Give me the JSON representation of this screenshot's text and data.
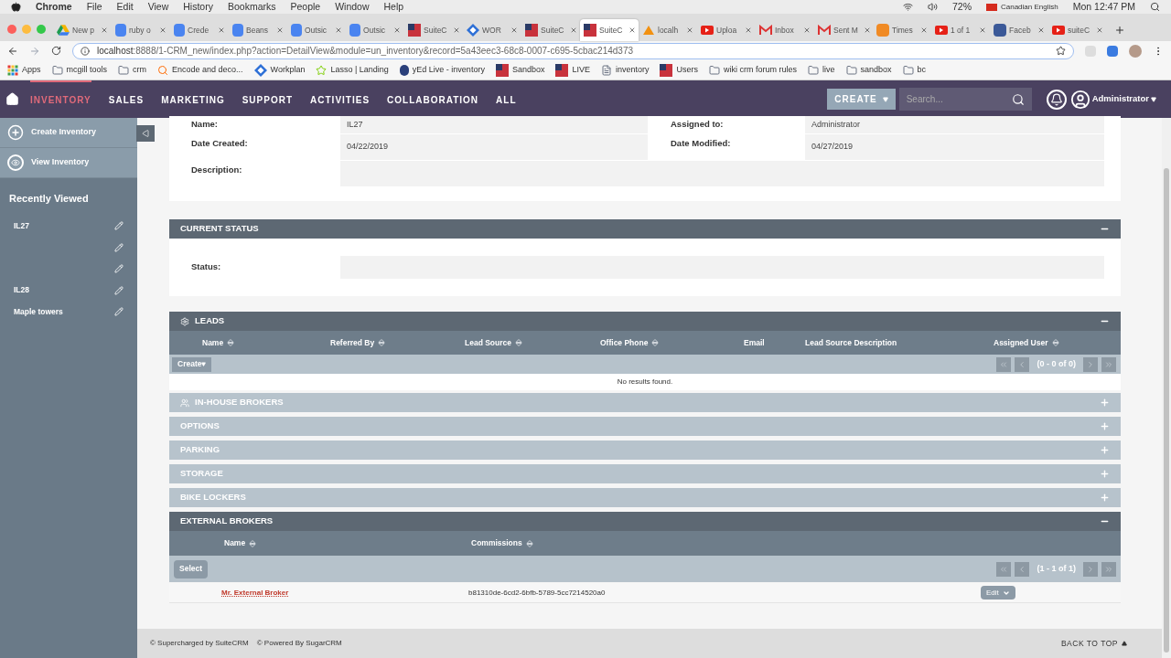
{
  "mac_menu": {
    "app": "Chrome",
    "items": [
      "File",
      "Edit",
      "View",
      "History",
      "Bookmarks",
      "People",
      "Window",
      "Help"
    ],
    "battery": "72%",
    "language": "Canadian English",
    "clock": "Mon 12:47 PM"
  },
  "browser_tabs": [
    {
      "label": "New p",
      "kind": "drive",
      "selected": false
    },
    {
      "label": "ruby o",
      "kind": "doc",
      "selected": false
    },
    {
      "label": "Crede",
      "kind": "doc",
      "selected": false
    },
    {
      "label": "Beans",
      "kind": "doc",
      "selected": false
    },
    {
      "label": "Outsic",
      "kind": "doc",
      "selected": false
    },
    {
      "label": "Outsic",
      "kind": "doc",
      "selected": false
    },
    {
      "label": "SuiteC",
      "kind": "suite",
      "selected": false
    },
    {
      "label": "WOR",
      "kind": "diamond",
      "selected": false
    },
    {
      "label": "SuiteC",
      "kind": "suite",
      "selected": false
    },
    {
      "label": "SuiteC",
      "kind": "suite",
      "selected": true
    },
    {
      "label": "localh",
      "kind": "pma",
      "selected": false
    },
    {
      "label": "Uploa",
      "kind": "youtube",
      "selected": false
    },
    {
      "label": "Inbox",
      "kind": "gmail",
      "selected": false
    },
    {
      "label": "Sent M",
      "kind": "gmail",
      "selected": false
    },
    {
      "label": "Times",
      "kind": "letter",
      "selected": false
    },
    {
      "label": "1 of 1",
      "kind": "youtube",
      "selected": false
    },
    {
      "label": "Faceb",
      "kind": "facebook",
      "selected": false
    },
    {
      "label": "suiteC",
      "kind": "youtube",
      "selected": false
    }
  ],
  "address_bar": {
    "host": "localhost",
    "path": ":8888/1-CRM_new/index.php?action=DetailView&module=un_inventory&record=5a43eec3-68c8-0007-c695-5cbac214d373"
  },
  "bookmarks": [
    {
      "label": "Apps",
      "kind": "apps"
    },
    {
      "label": "mcgill tools",
      "kind": "folder"
    },
    {
      "label": "crm",
      "kind": "folder"
    },
    {
      "label": "Encode and deco...",
      "kind": "search"
    },
    {
      "label": "Workplan",
      "kind": "diamond"
    },
    {
      "label": "Lasso | Landing",
      "kind": "star"
    },
    {
      "label": "yEd Live - inventory",
      "kind": "yed"
    },
    {
      "label": "Sandbox",
      "kind": "suite"
    },
    {
      "label": "LIVE",
      "kind": "suite"
    },
    {
      "label": "inventory",
      "kind": "page"
    },
    {
      "label": "Users",
      "kind": "suite"
    },
    {
      "label": "wiki crm forum rules",
      "kind": "folder"
    },
    {
      "label": "live",
      "kind": "folder"
    },
    {
      "label": "sandbox",
      "kind": "folder"
    },
    {
      "label": "bc",
      "kind": "folder"
    }
  ],
  "nav": {
    "items": [
      {
        "label": "INVENTORY",
        "selected": true
      },
      {
        "label": "SALES",
        "selected": false
      },
      {
        "label": "MARKETING",
        "selected": false
      },
      {
        "label": "SUPPORT",
        "selected": false
      },
      {
        "label": "ACTIVITIES",
        "selected": false
      },
      {
        "label": "COLLABORATION",
        "selected": false
      },
      {
        "label": "ALL",
        "selected": false
      }
    ],
    "create": "CREATE",
    "search_placeholder": "Search...",
    "user": "Administrator"
  },
  "sidebar": {
    "actions": [
      {
        "label": "Create Inventory",
        "kind": "create"
      },
      {
        "label": "View Inventory",
        "kind": "view"
      }
    ],
    "recently_viewed_title": "Recently Viewed",
    "recent": [
      {
        "kind": "named",
        "label": "IL27"
      },
      {
        "kind": "untitled"
      },
      {
        "kind": "untitled"
      },
      {
        "kind": "named",
        "label": "IL28"
      },
      {
        "kind": "named",
        "label": "Maple towers"
      }
    ]
  },
  "detail": {
    "rows": [
      [
        {
          "label": "Name:",
          "value": "IL27"
        },
        {
          "label": "Assigned to:",
          "value": "Administrator"
        }
      ],
      [
        {
          "label": "Date Created:",
          "value": "04/22/2019"
        },
        {
          "label": "Date Modified:",
          "value": "04/27/2019"
        }
      ],
      [
        {
          "label": "Description:"
        }
      ]
    ]
  },
  "current_status": {
    "title": "CURRENT STATUS",
    "expanded": true,
    "fields": [
      {
        "label": "Status:"
      }
    ]
  },
  "leads": {
    "title": "LEADS",
    "expanded": true,
    "columns": [
      {
        "label": "Name",
        "sortable": true
      },
      {
        "label": "Referred By",
        "sortable": true
      },
      {
        "label": "Lead Source",
        "sortable": true
      },
      {
        "label": "Office Phone",
        "sortable": true
      },
      {
        "label": "Email",
        "sortable": false
      },
      {
        "label": "Lead Source Description",
        "sortable": false
      },
      {
        "label": "Assigned User",
        "sortable": true
      }
    ],
    "action": "Create",
    "pager": "(0 - 0 of 0)",
    "empty": "No results found."
  },
  "collapsed_panels": [
    {
      "title": "IN-HOUSE BROKERS",
      "kind": "users",
      "expanded": false
    },
    {
      "title": "OPTIONS",
      "kind": "plain",
      "expanded": false
    },
    {
      "title": "PARKING",
      "kind": "plain",
      "expanded": false
    },
    {
      "title": "STORAGE",
      "kind": "plain",
      "expanded": false
    },
    {
      "title": "BIKE LOCKERS",
      "kind": "plain",
      "expanded": false
    }
  ],
  "external_brokers": {
    "title": "EXTERNAL BROKERS",
    "expanded": true,
    "columns": [
      {
        "label": "Name",
        "sortable": true
      },
      {
        "label": "Commissions",
        "sortable": true
      }
    ],
    "action": "Select",
    "pager": "(1 - 1 of 1)",
    "rows": [
      {
        "name": "Mr. External Broker",
        "commissions": "b81310de-6cd2-6bfb-5789-5cc7214520a0",
        "edit": "Edit"
      }
    ]
  },
  "footer": {
    "credits": [
      "© Supercharged by SuiteCRM",
      "© Powered By SugarCRM"
    ],
    "back_to_top": "BACK TO TOP"
  }
}
